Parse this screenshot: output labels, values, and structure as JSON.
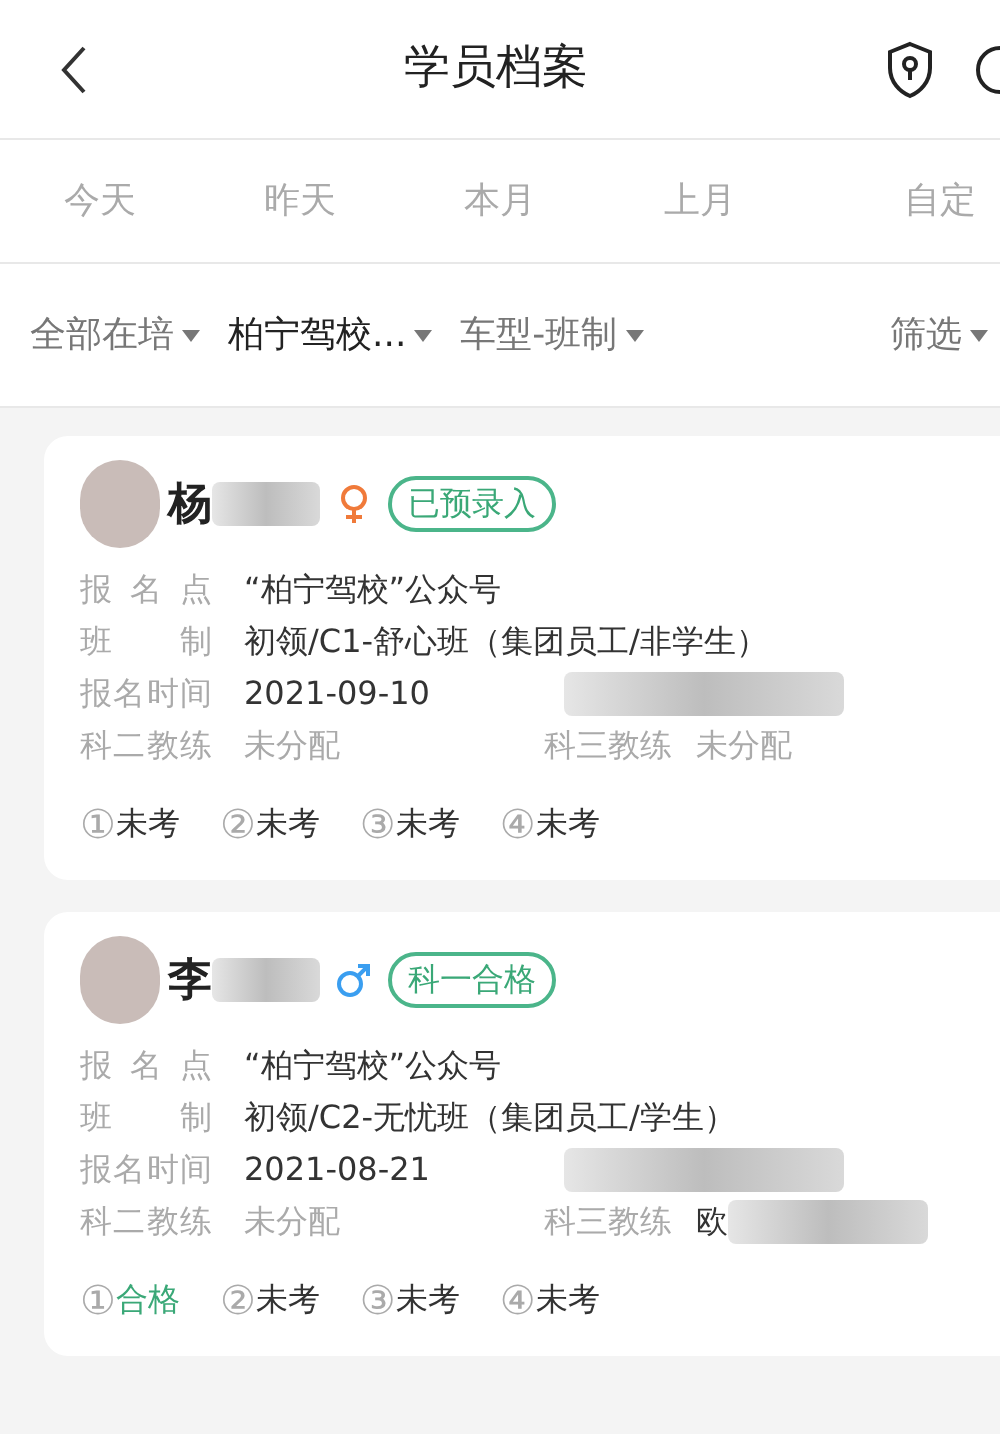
{
  "header": {
    "title": "学员档案"
  },
  "date_tabs": [
    {
      "label": "今天",
      "selected": false
    },
    {
      "label": "昨天",
      "selected": false
    },
    {
      "label": "本月",
      "selected": false
    },
    {
      "label": "上月",
      "selected": false
    },
    {
      "label": "自定",
      "selected": false
    }
  ],
  "filters": [
    {
      "label": "全部在培",
      "selected": false
    },
    {
      "label": "柏宁驾校...",
      "selected": true
    },
    {
      "label": "车型-班制",
      "selected": false
    },
    {
      "label": "筛选",
      "selected": false
    }
  ],
  "students": [
    {
      "name": "杨",
      "kind": "female",
      "badge": "已预录入",
      "info": [
        {
          "label": "报名点",
          "value": "“柏宁驾校”公众号"
        },
        {
          "label": "班制",
          "value": "初领/C1-舒心班（集团员工/非学生）"
        }
      ],
      "signup_label": "报名时间",
      "signup_date": "2021-09-10",
      "coach2_label": "科二教练",
      "coach2": "未分配",
      "coach3_label": "科三教练",
      "coach3": "未分配",
      "coach3_redacted": false,
      "exams": [
        {
          "num": "①",
          "status": "未考",
          "passed": false
        },
        {
          "num": "②",
          "status": "未考",
          "passed": false
        },
        {
          "num": "③",
          "status": "未考",
          "passed": false
        },
        {
          "num": "④",
          "status": "未考",
          "passed": false
        }
      ]
    },
    {
      "name": "李",
      "kind": "male",
      "badge": "科一合格",
      "info": [
        {
          "label": "报名点",
          "value": "“柏宁驾校”公众号"
        },
        {
          "label": "班制",
          "value": "初领/C2-无忧班（集团员工/学生）"
        }
      ],
      "signup_label": "报名时间",
      "signup_date": "2021-08-21",
      "coach2_label": "科二教练",
      "coach2": "未分配",
      "coach3_label": "科三教练",
      "coach3": "欧",
      "coach3_redacted": true,
      "exams": [
        {
          "num": "①",
          "status": "合格",
          "passed": true
        },
        {
          "num": "②",
          "status": "未考",
          "passed": false
        },
        {
          "num": "③",
          "status": "未考",
          "passed": false
        },
        {
          "num": "④",
          "status": "未考",
          "passed": false
        }
      ]
    }
  ]
}
